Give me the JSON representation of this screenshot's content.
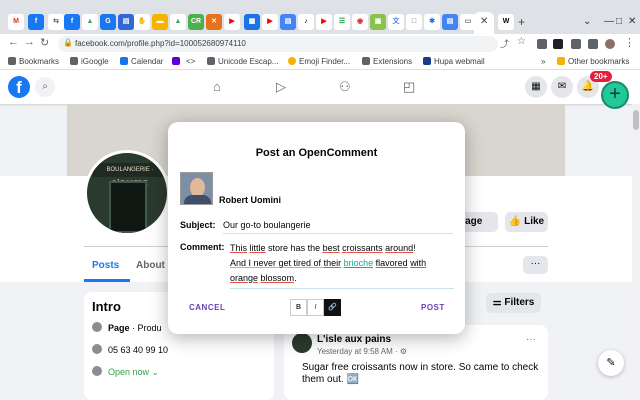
{
  "browser": {
    "url": "facebook.com/profile.php?id=100052680974110",
    "bookmarks": [
      {
        "label": "Bookmarks",
        "color": "#5f6368"
      },
      {
        "label": "iGoogle",
        "color": "#5f6368"
      },
      {
        "label": "Calendar",
        "color": "#1a73e8"
      },
      {
        "label": "<>",
        "color": "#1a73e8"
      },
      {
        "label": "Unicode Escap...",
        "color": "#5f6368"
      },
      {
        "label": "Emoji Finder...",
        "color": "#f4b400"
      },
      {
        "label": "Extensions",
        "color": "#5f6368"
      },
      {
        "label": "Hupa webmail",
        "color": "#1a3a8a"
      }
    ],
    "other_bookmarks": "Other bookmarks"
  },
  "facebook": {
    "logo_letter": "f",
    "notification_count": "20+",
    "fab_label": "+"
  },
  "profile": {
    "avatar_sign": "BOULANGERIE · PÂTISSERIE",
    "message_button": "ssage",
    "like_button": "Like",
    "tabs": [
      "Posts",
      "About"
    ],
    "more_button": "···"
  },
  "intro": {
    "title": "Intro",
    "page_prefix": "Page",
    "page_category": "· Produ",
    "phone": "05 63 40 99 10",
    "hours": "Open now ⌄"
  },
  "feed": {
    "filters_button": "Filters",
    "post": {
      "author": "L'isle aux pains",
      "time": "Yesterday at 9:58 AM · ⚙",
      "more": "···",
      "text": "Sugar free croissants now in store. So came to check them out. 🆗"
    }
  },
  "modal": {
    "title": "Post an OpenComment",
    "user_name": "Robert Uomini",
    "subject_label": "Subject:",
    "subject_value": "Our go-to boulangerie",
    "comment_label": "Comment:",
    "comment_line1": {
      "a": "This",
      "b": " ",
      "c": "little",
      "d": " store has the ",
      "e": "best",
      "f": " ",
      "g": "croissants",
      "h": " ",
      "i": "around",
      "j": "!"
    },
    "comment_line2": {
      "a": "And I never get tired of ",
      "b": "their",
      "c": " ",
      "d": "brioche",
      "e": " ",
      "f": "flavored",
      "g": " ",
      "h": "with"
    },
    "comment_line3": {
      "a": "orange",
      "b": " ",
      "c": "blossom",
      "d": "."
    },
    "cancel_label": "CANCEL",
    "post_label": "POST",
    "format_buttons": [
      "B",
      "I",
      "🔗"
    ]
  }
}
